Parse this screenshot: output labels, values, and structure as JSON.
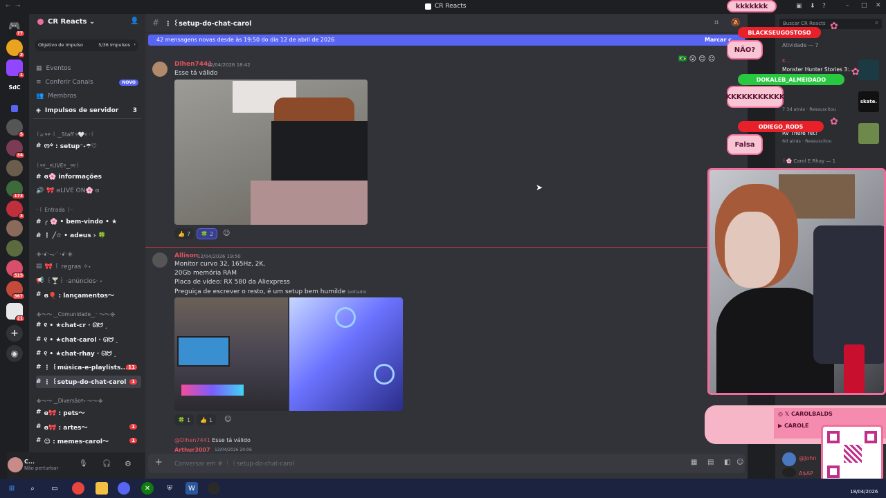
{
  "window": {
    "title": "CR Reacts"
  },
  "guild_badges": [
    "77",
    "3",
    "1",
    "SdC",
    "5",
    "34",
    "173",
    "3",
    "515",
    "367",
    "21"
  ],
  "server": {
    "name": "CR Reacts",
    "boost_goal_label": "Objetivo de impulso",
    "boost_count": "5/36 Impulsos"
  },
  "nav": [
    {
      "label": "Eventos"
    },
    {
      "label": "Conferir Canais",
      "badge": "NOVO"
    },
    {
      "label": "Membros"
    },
    {
      "label": "Impulsos de servidor",
      "count": "3"
    }
  ],
  "sidebar": {
    "cat_staff": "꒰ঌ·୨୧·꒱ ‿Staff ୨🤍୧ ·꒰",
    "ch_setup": "ᰔ꙳ : setup⁻˖☂︎♡",
    "cat_live": "꒰୨୧‿୨LIVE୧‿୨୧꒱",
    "ch_info": "ɞ🌸 informações",
    "ch_live_on": "🎀 ɞLIVE ON🌸 ɞ",
    "cat_entrada": "⁻꒰ Entrada ꒱⁻",
    "ch_welcome": "╭ 🌸 • bem-vindo • ★",
    "ch_adeus": "⋮ ╱☆ • adeus › 🍀",
    "cat_regras": "᯽·ꗃ·ᯓ·⠁·ꗃ·᯽",
    "ch_regras": "🎀 ꒰ regras ✧˖",
    "ch_anuncios": "꒰🍸꒱ ·anúncios· ˖",
    "ch_lancamentos": "ɞ🎈 : lançamentos〜",
    "cat_comunidade": "᯽〜〜 ‿Comunidade‿⁻ 〜〜᯽",
    "ch_chat_cr": "୧ • ★chat-cr · ᘏᗢ ˼",
    "ch_chat_carol": "୧ • ★chat-carol · ᘏᗢ ˼",
    "ch_chat_rhay": "୧ • ★chat-rhay · ᘏᗢ ˼",
    "ch_musica": "⋮ ꒰música-e-playlists...",
    "ch_musica_badge": "11",
    "ch_setup_carol": "⋮ ꒰setup-do-chat-carol",
    "ch_setup_carol_badge": "1",
    "cat_diversao": "᯽〜〜 ‿Diversão୧˖ 〜〜᯽",
    "ch_pets": "ɞ🎀 : pets〜",
    "ch_artes": "ɞ🎀 : artes〜",
    "ch_artes_badge": "1",
    "ch_memes": "😊 : memes-carol〜",
    "ch_memes_badge": "1"
  },
  "user_panel": {
    "name": "C...",
    "status": "Não perturbar"
  },
  "chat": {
    "channel_title": "⋮ ꒰setup-do-chat-carol",
    "new_banner": "42 mensagens novas desde às 19:50 do dia 12 de abril de 2026",
    "mark_read": "Marcar c",
    "input_placeholder": "Conversar em # ⋮ ꒰setup-do-chat-carol",
    "messages": [
      {
        "author": "Dlhen7441",
        "time": "12/04/2026 18:42",
        "text": "Esse tá válido"
      },
      {
        "author": "Allison",
        "time": "12/04/2026 19:50",
        "lines": [
          "Monitor curvo 32, 165Hz, 2K,",
          "20Gb memória RAM",
          "Placa de vídeo: RX 580 da Aliexpress",
          "Preguiça de escrever o resto, é um setup bem humilde"
        ],
        "edited": "(editado)"
      }
    ],
    "reactions_1": [
      {
        "emoji": "👍",
        "count": "7"
      },
      {
        "emoji": "🍀",
        "count": "2"
      }
    ],
    "reactions_2": [
      {
        "emoji": "🍀",
        "count": "1"
      },
      {
        "emoji": "👍",
        "count": "1"
      }
    ],
    "reply_preview": {
      "author": "@Dlhen7441",
      "text": "Esse tá válido",
      "next_author": "Arthur3007",
      "next_time": "12/04/2026 20:06"
    }
  },
  "members": {
    "search_placeholder": "Buscar CR Reacts",
    "activity_header": "Atividade — 7",
    "items": [
      {
        "title": "K...",
        "subtitle": "Monster Hunter Stories 3:..."
      },
      {
        "title": "skate.",
        "subtitle": "7 3d atrás · Ressuscitou"
      },
      {
        "title": "RV There Yet?",
        "subtitle": "6d atrás · Ressuscitou"
      }
    ],
    "role_header": "꒰🌸 Carol E Rhay — 1",
    "bottom_names": [
      "@John",
      "A$AP"
    ]
  },
  "overlay": {
    "bubbles": [
      "kkkkkkk",
      "NÃO?",
      "KKKKKKKKKKK",
      "Falsa"
    ],
    "pills": [
      {
        "label": "BLACKSEUGOSTOSO",
        "color": "#e8202a"
      },
      {
        "label": "DOKALEB_ALMEIDADO",
        "color": "#28c840"
      },
      {
        "label": "ODIEGO_RODS",
        "color": "#e8202a"
      }
    ],
    "social_x": "CAROLBALDS",
    "social_yt": "CAROLE"
  },
  "taskbar": {
    "date": "18/04/2026"
  }
}
